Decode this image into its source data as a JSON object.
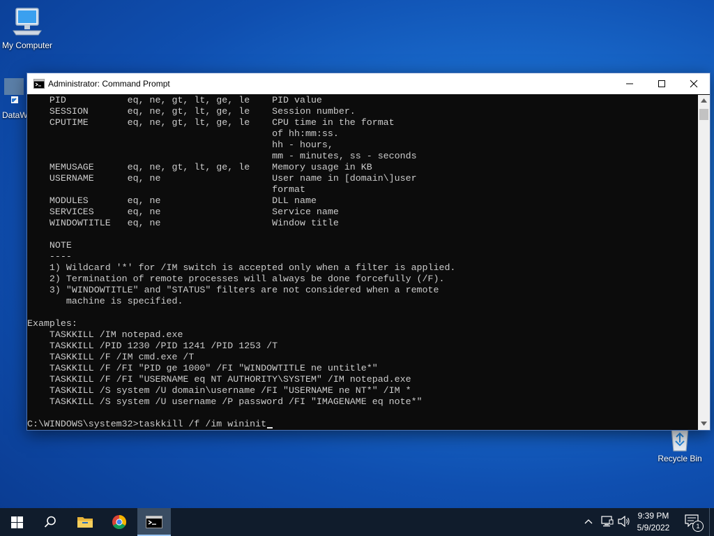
{
  "desktop": {
    "icons": [
      {
        "label": "My Computer",
        "icon": "computer-icon"
      },
      {
        "label": "DataW",
        "icon": "shortcut-icon"
      },
      {
        "label": "Recycle Bin",
        "icon": "recycle-bin-icon"
      }
    ]
  },
  "window": {
    "title": "Administrator: Command Prompt",
    "app_icon": "cmd-icon",
    "controls": {
      "minimize": "minimize-icon",
      "maximize": "maximize-icon",
      "close": "close-icon"
    }
  },
  "console": {
    "lines": [
      "    PID           eq, ne, gt, lt, ge, le    PID value",
      "    SESSION       eq, ne, gt, lt, ge, le    Session number.",
      "    CPUTIME       eq, ne, gt, lt, ge, le    CPU time in the format",
      "                                            of hh:mm:ss.",
      "                                            hh - hours,",
      "                                            mm - minutes, ss - seconds",
      "    MEMUSAGE      eq, ne, gt, lt, ge, le    Memory usage in KB",
      "    USERNAME      eq, ne                    User name in [domain\\]user",
      "                                            format",
      "    MODULES       eq, ne                    DLL name",
      "    SERVICES      eq, ne                    Service name",
      "    WINDOWTITLE   eq, ne                    Window title",
      "",
      "    NOTE",
      "    ----",
      "    1) Wildcard '*' for /IM switch is accepted only when a filter is applied.",
      "    2) Termination of remote processes will always be done forcefully (/F).",
      "    3) \"WINDOWTITLE\" and \"STATUS\" filters are not considered when a remote",
      "       machine is specified.",
      "",
      "Examples:",
      "    TASKKILL /IM notepad.exe",
      "    TASKKILL /PID 1230 /PID 1241 /PID 1253 /T",
      "    TASKKILL /F /IM cmd.exe /T",
      "    TASKKILL /F /FI \"PID ge 1000\" /FI \"WINDOWTITLE ne untitle*\"",
      "    TASKKILL /F /FI \"USERNAME eq NT AUTHORITY\\SYSTEM\" /IM notepad.exe",
      "    TASKKILL /S system /U domain\\username /FI \"USERNAME ne NT*\" /IM *",
      "    TASKKILL /S system /U username /P password /FI \"IMAGENAME eq note*\"",
      ""
    ],
    "prompt": "C:\\WINDOWS\\system32>",
    "input": "taskkill /f /im wininit"
  },
  "taskbar": {
    "buttons": [
      {
        "name": "start",
        "icon": "windows-logo-icon"
      },
      {
        "name": "search",
        "icon": "search-icon"
      },
      {
        "name": "file-explorer",
        "icon": "folder-icon"
      },
      {
        "name": "chrome",
        "icon": "chrome-icon"
      },
      {
        "name": "command-prompt",
        "icon": "cmd-icon",
        "active": true
      }
    ],
    "tray": {
      "time": "9:39 PM",
      "date": "5/9/2022",
      "notification_count": "1"
    }
  },
  "colors": {
    "console_bg": "#0c0c0c",
    "console_fg": "#cccccc",
    "taskbar_bg": "#101c2c",
    "desktop_accent": "#1b6fd1"
  }
}
